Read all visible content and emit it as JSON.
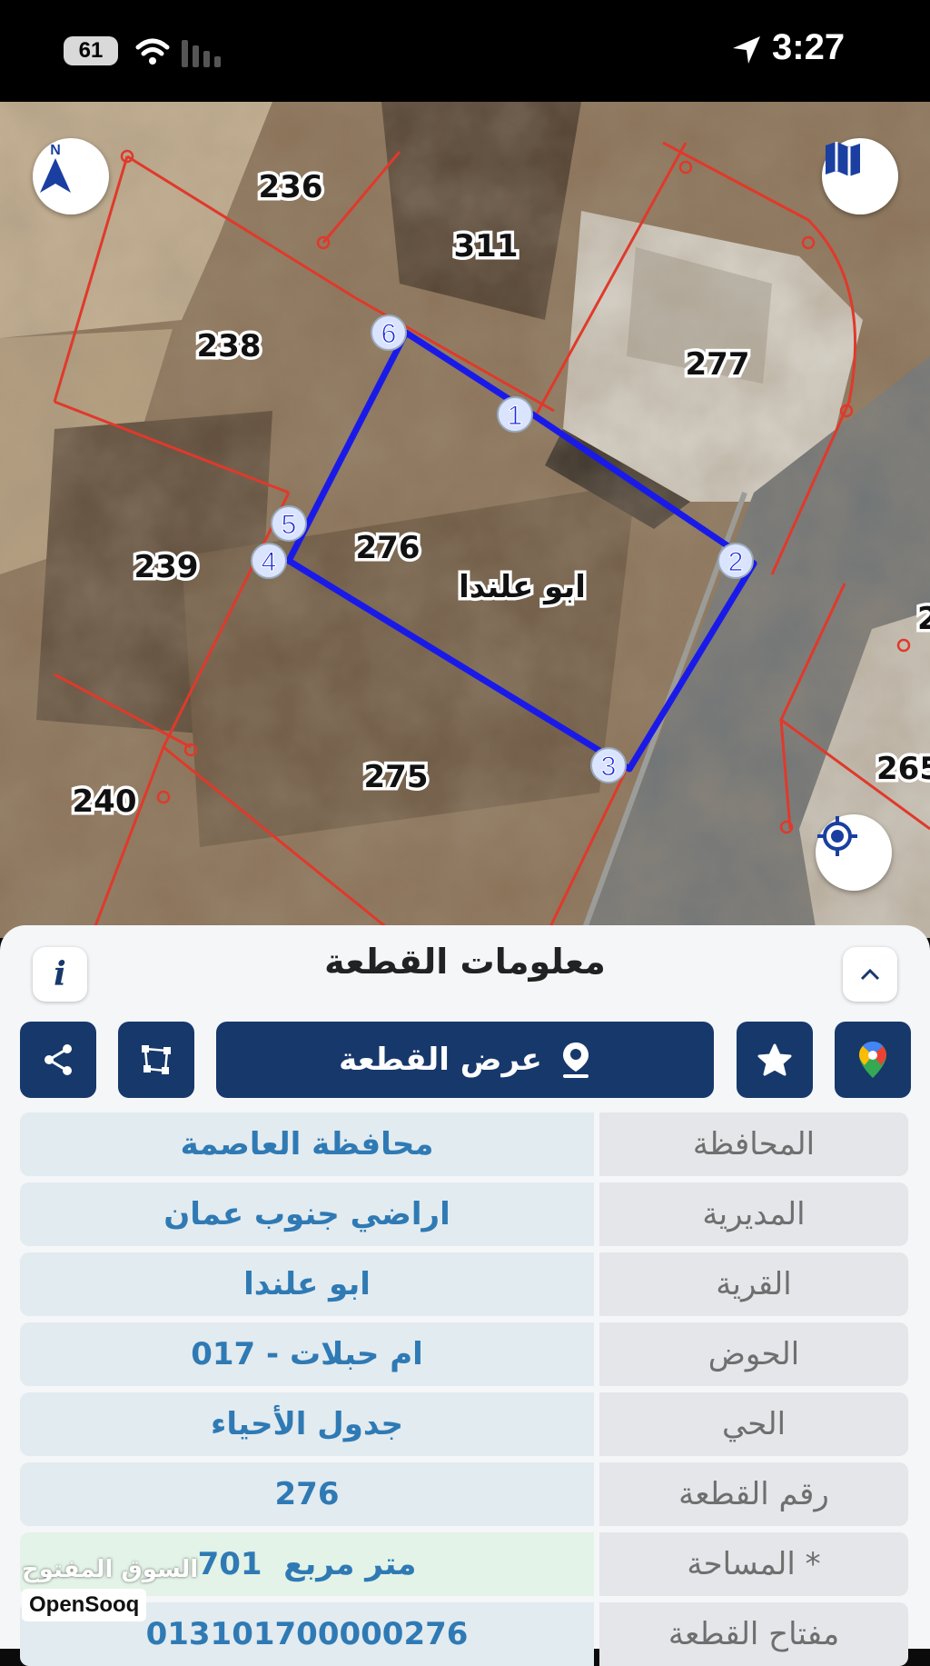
{
  "status_bar": {
    "battery": "61",
    "time": "3:27"
  },
  "map": {
    "compass_label": "N",
    "parcels": [
      "236",
      "311",
      "238",
      "277",
      "239",
      "276",
      "275",
      "240",
      "265",
      "2"
    ],
    "village_label": "ابو علندا",
    "vertices": [
      "1",
      "2",
      "3",
      "4",
      "5",
      "6"
    ],
    "colors": {
      "parcel_border": "#e0392b",
      "selected_border": "#1a1ae8"
    }
  },
  "panel": {
    "title": "معلومات القطعة",
    "info_label": "i",
    "show_parcel_label": "عرض القطعة",
    "rows": [
      {
        "label": "المحافظة",
        "value": "محافظة العاصمة"
      },
      {
        "label": "المديرية",
        "value": "اراضي جنوب عمان"
      },
      {
        "label": "القرية",
        "value": "ابو علندا"
      },
      {
        "label": "الحوض",
        "value": "ام حبلات - 017"
      },
      {
        "label": "الحي",
        "value": "جدول الأحياء"
      },
      {
        "label": "رقم القطعة",
        "value": "276"
      },
      {
        "label": "المساحة *",
        "value": "701  متر مربع"
      },
      {
        "label": "مفتاح القطعة",
        "value": "013101700000276"
      }
    ],
    "colors": {
      "button": "#17386b",
      "value_text": "#2f7ab4"
    }
  },
  "watermark": {
    "arabic": "السوق المفتوح",
    "english": "OpenSooq"
  }
}
